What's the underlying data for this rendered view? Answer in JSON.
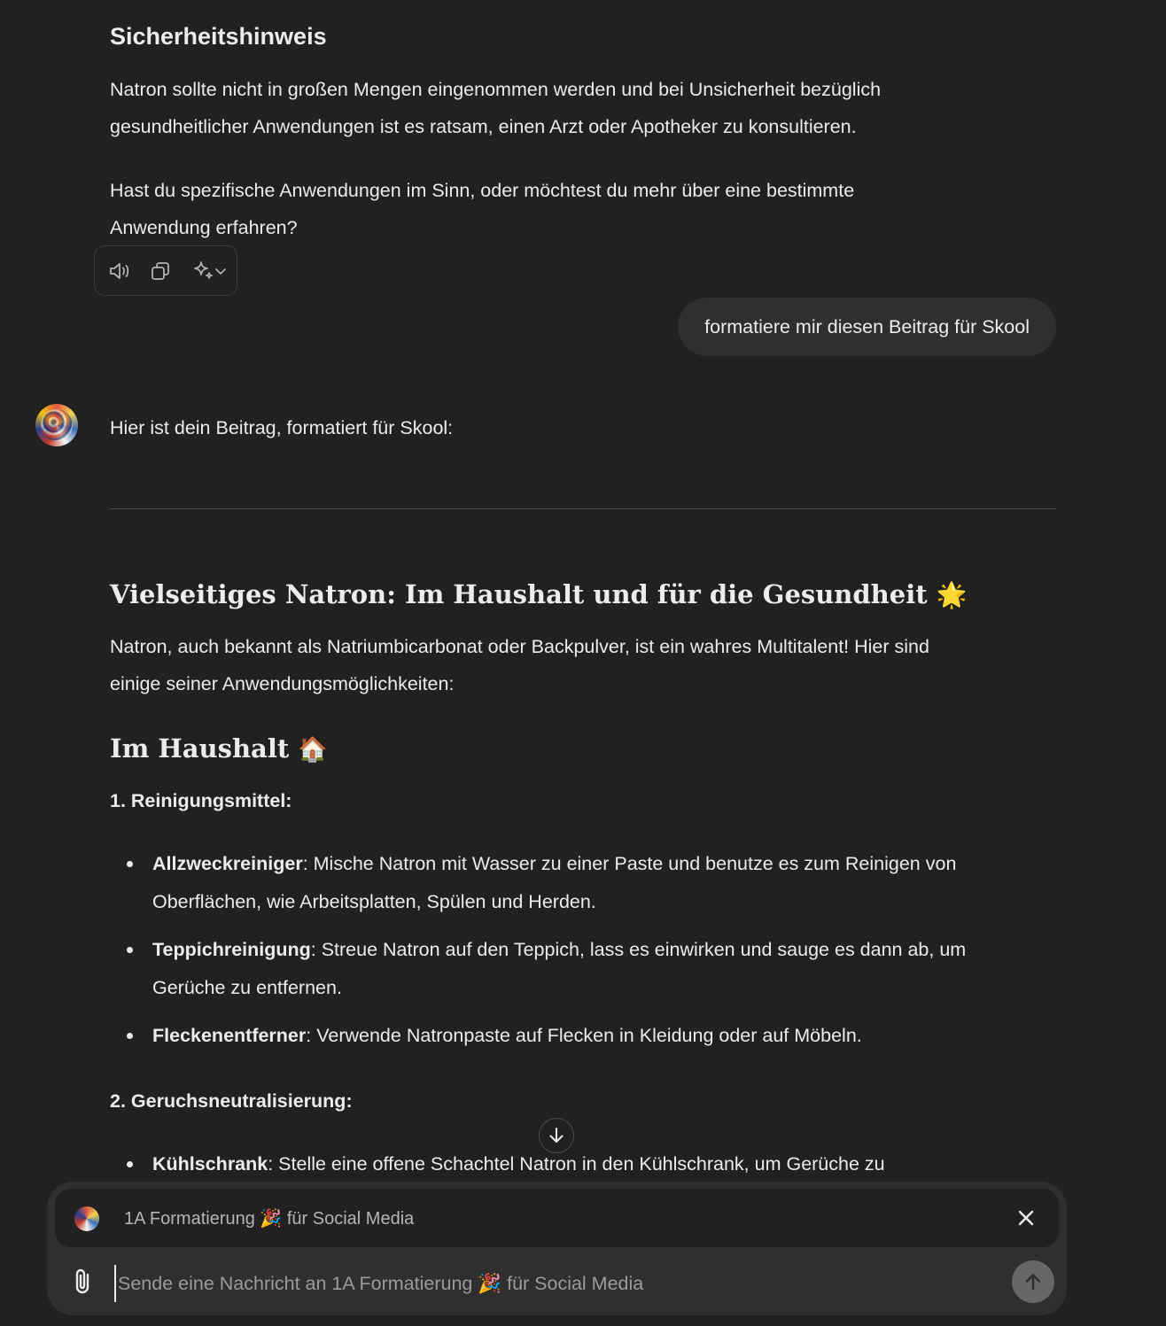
{
  "previous_reply": {
    "heading": "Sicherheitshinweis",
    "para1_line1": "Natron sollte nicht in großen Mengen eingenommen werden und bei Unsicherheit bezüglich",
    "para1_line2": "gesundheitlicher Anwendungen ist es ratsam, einen Arzt oder Apotheker zu konsultieren.",
    "para2_line1": "Hast du spezifische Anwendungen im Sinn, oder möchtest du mehr über eine bestimmte",
    "para2_line2": "Anwendung erfahren?"
  },
  "toolbar": {
    "icons": [
      "speaker-icon",
      "copy-icon",
      "sparkle-icon",
      "chevron-down-icon"
    ]
  },
  "user_message": "formatiere mir diesen Beitrag für Skool",
  "assistant": {
    "intro": "Hier ist dein Beitrag, formatiert für Skool:",
    "title": "Vielseitiges Natron: Im Haushalt und für die Gesundheit",
    "title_emoji": "🌟",
    "intro_line1": "Natron, auch bekannt als Natriumbicarbonat oder Backpulver, ist ein wahres Multitalent! Hier sind",
    "intro_line2": "einige seiner Anwendungsmöglichkeiten:",
    "section_heading": "Im Haushalt",
    "section_emoji": "🏠",
    "sub1": "1. Reinigungsmittel:",
    "items1": [
      {
        "term": "Allzweckreiniger",
        "line1": ": Mische Natron mit Wasser zu einer Paste und benutze es zum Reinigen von",
        "line2": "Oberflächen, wie Arbeitsplatten, Spülen und Herden."
      },
      {
        "term": "Teppichreinigung",
        "line1": ": Streue Natron auf den Teppich, lass es einwirken und sauge es dann ab, um",
        "line2": "Gerüche zu entfernen."
      },
      {
        "term": "Fleckenentferner",
        "line1": ": Verwende Natronpaste auf Flecken in Kleidung oder auf Möbeln.",
        "line2": ""
      }
    ],
    "sub2": "2. Geruchsneutralisierung:",
    "items2": [
      {
        "term": "Kühlschrank",
        "line1": ": Stelle eine offene Schachtel Natron in den Kühlschrank, um Gerüche zu"
      }
    ]
  },
  "composer": {
    "gpt_name": "1A Formatierung 🎉 für Social Media",
    "placeholder": "Sende eine Nachricht an 1A Formatierung 🎉 für Social Media",
    "value": ""
  }
}
